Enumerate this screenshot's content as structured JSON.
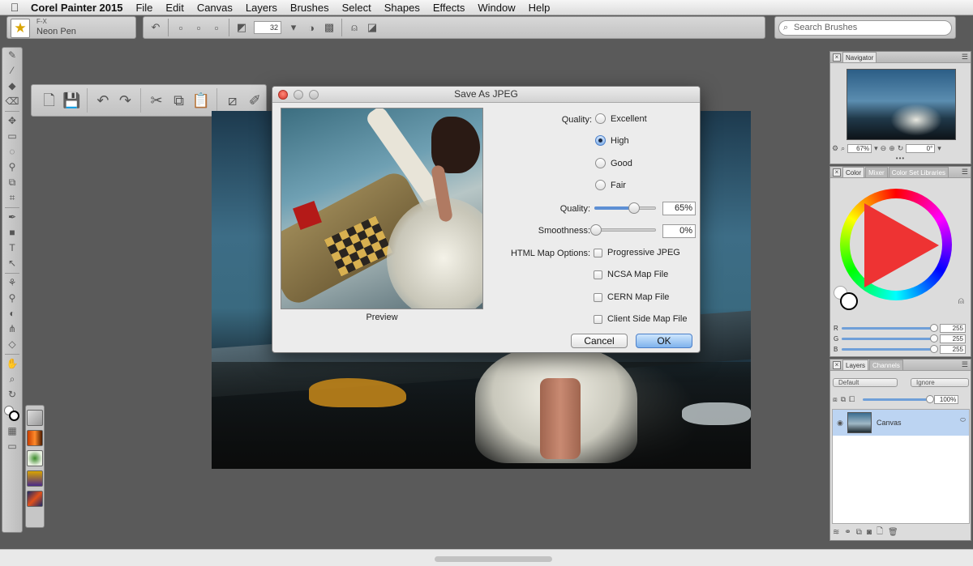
{
  "menubar": {
    "app_name": "Corel Painter 2015",
    "items": [
      "File",
      "Edit",
      "Canvas",
      "Layers",
      "Brushes",
      "Select",
      "Shapes",
      "Effects",
      "Window",
      "Help"
    ]
  },
  "brush_selector": {
    "category": "F-X",
    "variant": "Neon Pen",
    "icon": "star-icon"
  },
  "property_bar": {
    "size_value": "32"
  },
  "search": {
    "placeholder": "Search Brushes"
  },
  "navigator": {
    "tab": "Navigator",
    "zoom": "67%",
    "rotation": "0°"
  },
  "color_panel": {
    "tabs": [
      "Color",
      "Mixer",
      "Color Set Libraries"
    ],
    "rgb": [
      {
        "label": "R",
        "value": "255"
      },
      {
        "label": "G",
        "value": "255"
      },
      {
        "label": "B",
        "value": "255"
      }
    ],
    "main_color": "#ffffff"
  },
  "layers_panel": {
    "tabs": [
      "Layers",
      "Channels"
    ],
    "composite_method": "Default",
    "preserve": "Ignore",
    "opacity": "100%",
    "layer_name": "Canvas"
  },
  "dialog": {
    "title": "Save As JPEG",
    "preview_label": "Preview",
    "quality_label": "Quality:",
    "quality_options": [
      "Excellent",
      "High",
      "Good",
      "Fair"
    ],
    "quality_selected": "High",
    "quality_slider_label": "Quality:",
    "quality_value": "65%",
    "quality_fraction": 0.65,
    "smoothness_label": "Smoothness:",
    "smoothness_value": "0%",
    "smoothness_fraction": 0.0,
    "html_map_label": "HTML Map Options:",
    "checkboxes": [
      "Progressive JPEG",
      "NCSA Map File",
      "CERN Map File",
      "Client Side Map File"
    ],
    "cancel_label": "Cancel",
    "ok_label": "OK"
  }
}
